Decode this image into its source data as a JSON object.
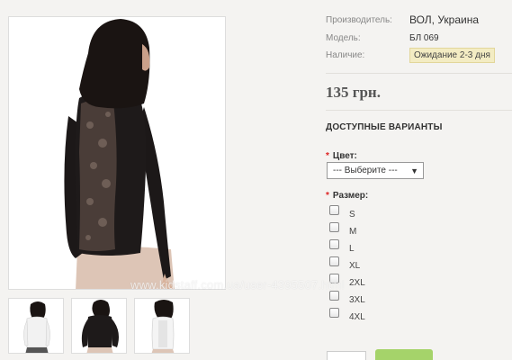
{
  "product": {
    "manufacturer_label": "Производитель:",
    "manufacturer_value": "ВОЛ, Украина",
    "model_label": "Модель:",
    "model_value": "БЛ 069",
    "availability_label": "Наличие:",
    "availability_value": "Ожидание 2-3 дня",
    "price": "135 грн."
  },
  "options": {
    "heading": "ДОСТУПНЫЕ ВАРИАНТЫ",
    "required_mark": "*",
    "color_label": "Цвет:",
    "color_selected": "--- Выберите ---",
    "size_label": "Размер:",
    "sizes": [
      "S",
      "M",
      "L",
      "XL",
      "2XL",
      "3XL",
      "4XL"
    ]
  },
  "watermark": "www.kidstaff.com.ua/user-4395507.html",
  "colors": {
    "accent_button": "#a5d36a",
    "badge_bg": "#f3ecc3",
    "required": "#dd2222"
  }
}
